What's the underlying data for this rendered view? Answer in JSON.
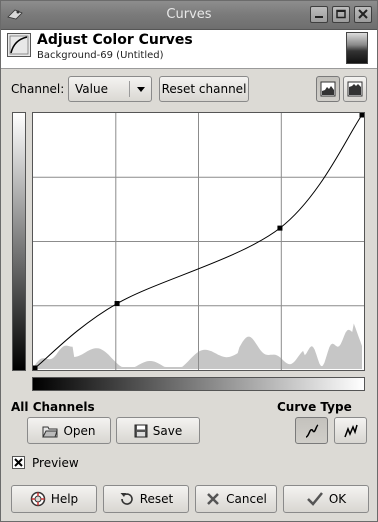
{
  "window": {
    "title": "Curves"
  },
  "header": {
    "title": "Adjust Color Curves",
    "subtitle": "Background-69 (Untitled)"
  },
  "channel": {
    "label": "Channel:",
    "value": "Value",
    "reset_label": "Reset channel"
  },
  "curve": {
    "points": [
      [
        0,
        0
      ],
      [
        64,
        65
      ],
      [
        191,
        141
      ],
      [
        255,
        255
      ]
    ],
    "range": [
      0,
      255
    ]
  },
  "all_channels": {
    "label": "All Channels",
    "open_label": "Open",
    "save_label": "Save"
  },
  "curve_type": {
    "label": "Curve Type",
    "selected": "smooth"
  },
  "preview": {
    "label": "Preview",
    "checked": true
  },
  "footer": {
    "help_label": "Help",
    "reset_label": "Reset",
    "cancel_label": "Cancel",
    "ok_label": "OK"
  },
  "colors": {
    "histogram": "#c6c6c6",
    "grid": "#8c8c8c",
    "curve": "#000000"
  }
}
